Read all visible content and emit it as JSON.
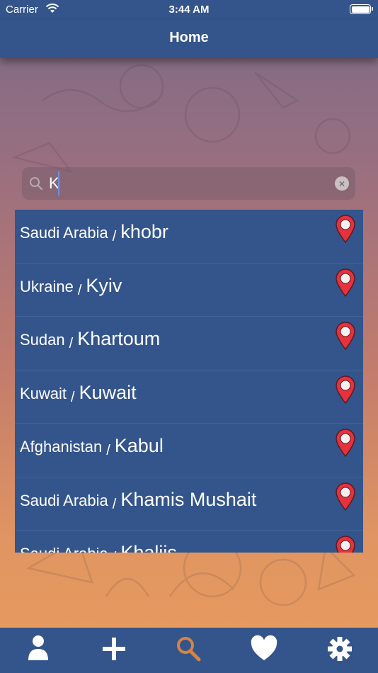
{
  "status_bar": {
    "carrier": "Carrier",
    "time": "3:44 AM"
  },
  "nav": {
    "title": "Home"
  },
  "search": {
    "value": "K",
    "clear_icon": "clear-icon",
    "search_icon": "search-icon"
  },
  "results": [
    {
      "country": "Saudi Arabia",
      "separator": "/",
      "city": "khobr"
    },
    {
      "country": "Ukraine",
      "separator": "/",
      "city": "Kyiv"
    },
    {
      "country": "Sudan",
      "separator": "/",
      "city": "Khartoum"
    },
    {
      "country": "Kuwait",
      "separator": "/",
      "city": "Kuwait"
    },
    {
      "country": "Afghanistan",
      "separator": "/",
      "city": "Kabul"
    },
    {
      "country": "Saudi Arabia",
      "separator": "/",
      "city": "Khamis Mushait"
    },
    {
      "country": "Saudi Arabia",
      "separator": "/",
      "city": "Khaliis"
    }
  ],
  "tabs": [
    {
      "icon": "profile-icon",
      "active": false
    },
    {
      "icon": "add-icon",
      "active": false
    },
    {
      "icon": "search-icon",
      "active": true
    },
    {
      "icon": "heart-icon",
      "active": false
    },
    {
      "icon": "gear-icon",
      "active": false
    }
  ],
  "colors": {
    "bar": "#34558b",
    "active_tab": "#d8843c",
    "pin": "#e5323c"
  }
}
